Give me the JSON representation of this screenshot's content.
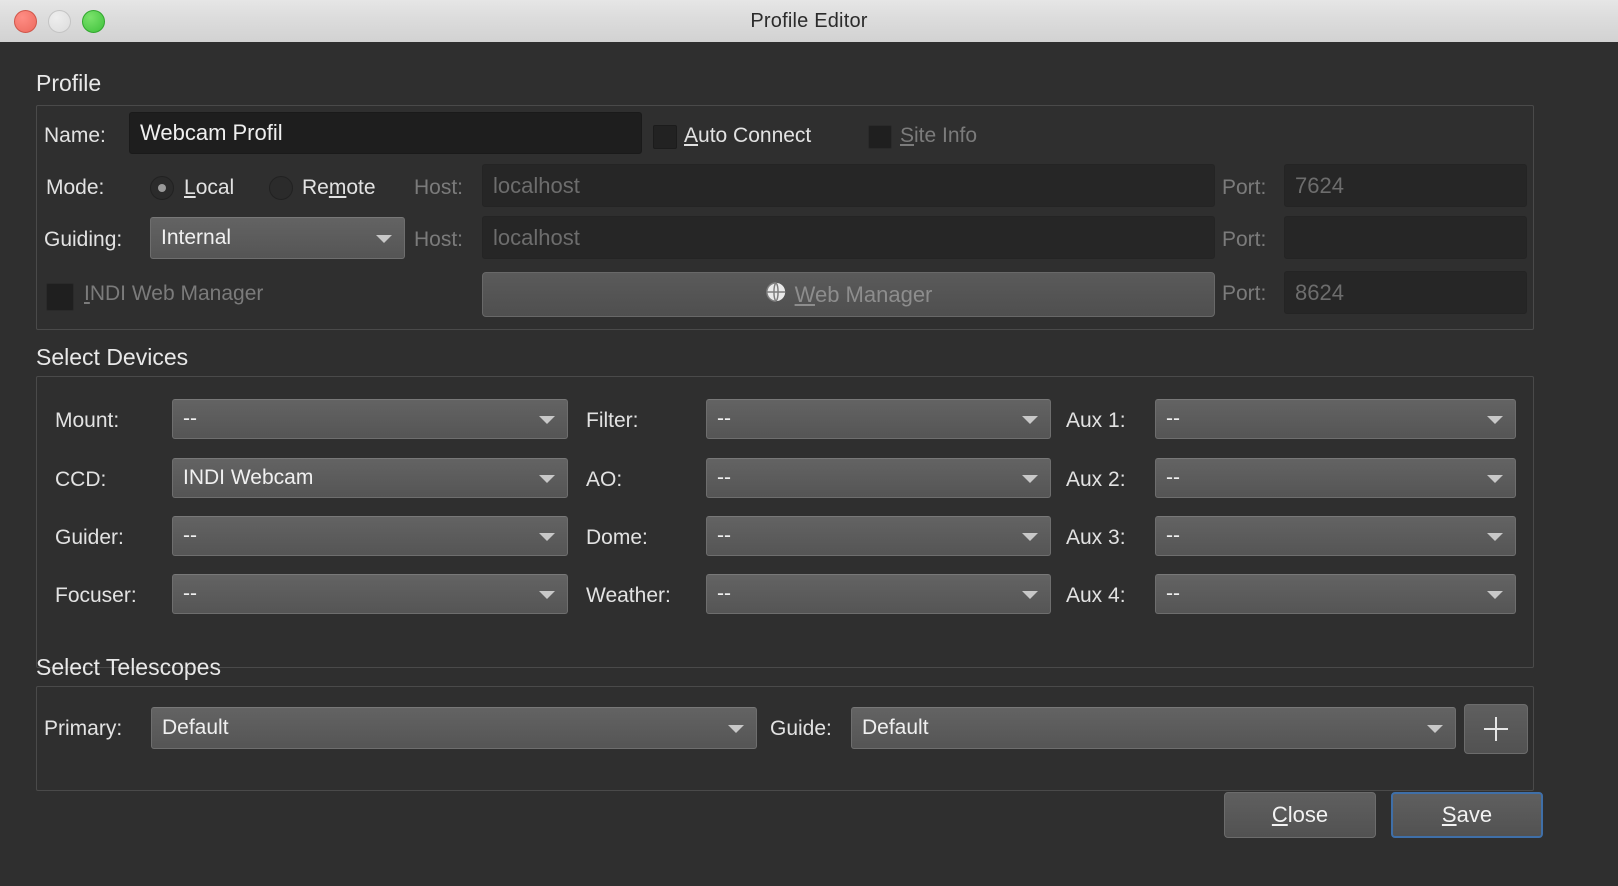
{
  "window": {
    "title": "Profile Editor",
    "controls": {
      "close": "close-button",
      "minimize": "minimize-button",
      "maximize": "maximize-button"
    }
  },
  "profile_section": {
    "title": "Profile",
    "name_label": "Name:",
    "name_value": "Webcam Profil",
    "auto_connect_label": "Auto Connect",
    "auto_connect_checked": false,
    "site_info_label": "Site Info",
    "site_info_checked": false,
    "site_info_disabled": true,
    "mode_label": "Mode:",
    "mode_local_label": "Local",
    "mode_remote_label": "Remote",
    "mode_selected": "Local",
    "mode_host_label": "Host:",
    "mode_host_value": "localhost",
    "mode_port_label": "Port:",
    "mode_port_value": "7624",
    "guiding_label": "Guiding:",
    "guiding_value": "Internal",
    "guiding_host_label": "Host:",
    "guiding_host_value": "localhost",
    "guiding_port_label": "Port:",
    "guiding_port_value": "",
    "indi_web_manager_label": "INDI Web Manager",
    "indi_web_manager_checked": false,
    "web_manager_button_label": "Web Manager",
    "web_manager_icon": "globe-icon",
    "web_manager_port_label": "Port:",
    "web_manager_port_value": "8624"
  },
  "devices_section": {
    "title": "Select Devices",
    "columns": [
      {
        "rows": [
          {
            "label": "Mount:",
            "value": "--"
          },
          {
            "label": "CCD:",
            "value": "INDI Webcam"
          },
          {
            "label": "Guider:",
            "value": "--"
          },
          {
            "label": "Focuser:",
            "value": "--"
          }
        ]
      },
      {
        "rows": [
          {
            "label": "Filter:",
            "value": "--"
          },
          {
            "label": "AO:",
            "value": "--"
          },
          {
            "label": "Dome:",
            "value": "--"
          },
          {
            "label": "Weather:",
            "value": "--"
          }
        ]
      },
      {
        "rows": [
          {
            "label": "Aux 1:",
            "value": "--"
          },
          {
            "label": "Aux 2:",
            "value": "--"
          },
          {
            "label": "Aux 3:",
            "value": "--"
          },
          {
            "label": "Aux 4:",
            "value": "--"
          }
        ]
      }
    ]
  },
  "telescopes_section": {
    "title": "Select Telescopes",
    "primary_label": "Primary:",
    "primary_value": "Default",
    "guide_label": "Guide:",
    "guide_value": "Default",
    "add_button_label": "+",
    "add_button_icon": "plus-icon"
  },
  "footer": {
    "close_label": "Close",
    "save_label": "Save",
    "default_button": "Save"
  },
  "colors": {
    "window_bg": "#2f2f2f",
    "titlebar_bg": "#dcdcdc",
    "field_bg": "#1e1e1e",
    "combo_bg": "#5a5a5a",
    "text": "#e2e2e2",
    "text_disabled": "#7b7b7b",
    "focus_border": "#3f6fa8",
    "light_red": "#ec6a5e",
    "light_yellow": "#dcdcdc",
    "light_green": "#3fc13c"
  }
}
